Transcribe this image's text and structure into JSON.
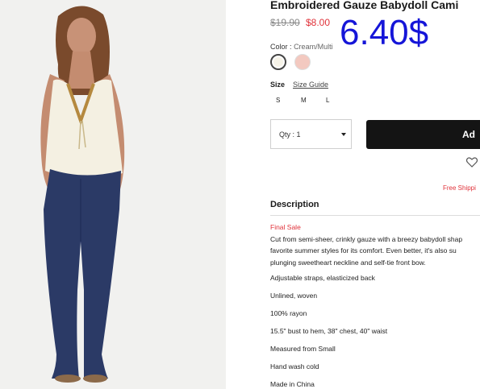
{
  "product": {
    "title": "Embroidered Gauze Babydoll Cami",
    "price_old": "$19.90",
    "price_new": "$8.00",
    "overlay_price": "6.40$"
  },
  "color": {
    "label": "Color",
    "separator": ":",
    "selected": "Cream/Multi",
    "swatches": [
      "#f6f3e8",
      "#f3c9c0"
    ]
  },
  "size": {
    "label": "Size",
    "guide": "Size Guide",
    "options": [
      "S",
      "M",
      "L"
    ]
  },
  "quantity": {
    "label": "Qty : 1"
  },
  "add_button": {
    "label": "Ad"
  },
  "free_shipping": "Free Shippi",
  "description": {
    "heading": "Description",
    "final_sale": "Final Sale",
    "lines": [
      "Cut from semi-sheer, crinkly gauze with a breezy babydoll shap",
      "favorite summer styles for its comfort. Even better, it's also su",
      "plunging sweetheart neckline and self-tie front bow."
    ],
    "specs": [
      "Adjustable straps, elasticized back",
      "Unlined, woven",
      "100% rayon",
      "15.5\" bust to hem, 38\" chest, 40\" waist",
      "Measured from Small",
      "Hand wash cold",
      "Made in China"
    ]
  },
  "colors": {
    "sale_red": "#e0323a",
    "overlay_blue": "#1515d8",
    "button_black": "#141414"
  }
}
